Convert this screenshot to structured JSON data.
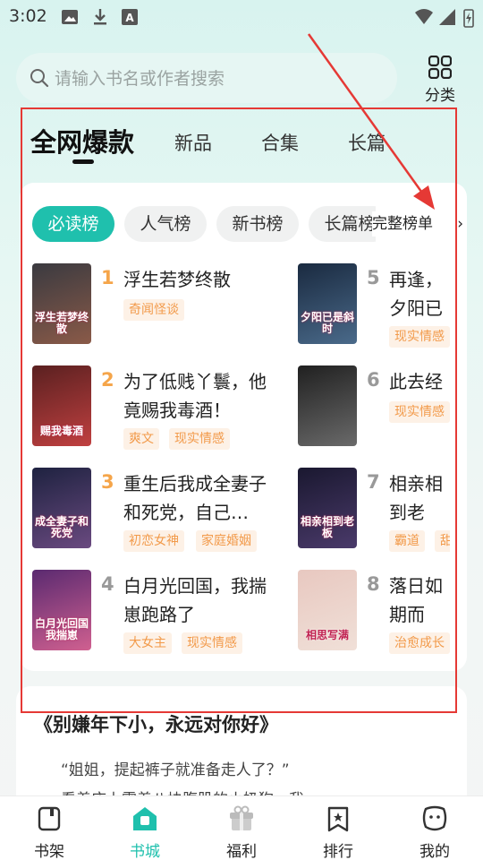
{
  "status": {
    "time": "3:02"
  },
  "search": {
    "placeholder": "请输入书名或作者搜索"
  },
  "category": {
    "label": "分类"
  },
  "main_tabs": [
    {
      "label": "全网爆款",
      "active": true
    },
    {
      "label": "新品"
    },
    {
      "label": "合集"
    },
    {
      "label": "长篇"
    }
  ],
  "chips": [
    {
      "label": "必读榜",
      "active": true
    },
    {
      "label": "人气榜"
    },
    {
      "label": "新书榜"
    },
    {
      "label": "长篇榜"
    }
  ],
  "full_list": {
    "label": "完整榜单"
  },
  "books": [
    {
      "rank": "1",
      "title": "浮生若梦终散",
      "tags": [
        "奇闻怪谈"
      ],
      "cover_text": "浮生若梦终散",
      "cover_colors": [
        "#3a3a40",
        "#8a5a48"
      ]
    },
    {
      "rank": "2",
      "title": "为了低贱丫鬟，他竟赐我毒酒！",
      "tags": [
        "爽文",
        "现实情感"
      ],
      "cover_text": "赐我毒酒",
      "cover_colors": [
        "#5a2020",
        "#c04040"
      ]
    },
    {
      "rank": "3",
      "title": "重生后我成全妻子和死党，自己…",
      "tags": [
        "初恋女神",
        "家庭婚姻"
      ],
      "cover_text": "成全妻子和死党",
      "cover_colors": [
        "#1e2240",
        "#6a4a80"
      ]
    },
    {
      "rank": "4",
      "title": "白月光回国，我揣崽跑路了",
      "tags": [
        "大女主",
        "现实情感"
      ],
      "cover_text": "白月光回国我揣崽",
      "cover_colors": [
        "#5a2a70",
        "#d06090"
      ]
    },
    {
      "rank": "5",
      "title": "再逢，夕阳已是斜时",
      "tags": [
        "现实情感"
      ],
      "cover_text": "夕阳已是斜时",
      "cover_colors": [
        "#1a2a40",
        "#4a6a8a"
      ]
    },
    {
      "rank": "6",
      "title": "此去经年",
      "tags": [
        "现实情感"
      ],
      "cover_text": "",
      "cover_colors": [
        "#202020",
        "#6a6a6a"
      ]
    },
    {
      "rank": "7",
      "title": "相亲相到老板，一尖种怎样的体验",
      "tags": [
        "霸道",
        "甜宠"
      ],
      "cover_text": "相亲相到老板",
      "cover_colors": [
        "#1a1830",
        "#4a3a6a"
      ]
    },
    {
      "rank": "8",
      "title": "落日如期而至，相思写满",
      "tags": [
        "治愈成长"
      ],
      "cover_text": "相思写满",
      "cover_colors": [
        "#e8c8c0",
        "#f0e0d8"
      ]
    }
  ],
  "recommendation": {
    "title": "《别嫌年下小，永远对你好》",
    "quote": "“姐姐，提起裤子就准备走人了？”",
    "line": "看着床上露着八块腹肌的小奶狗，我"
  },
  "bottom_nav": [
    {
      "label": "书架",
      "icon": "bookshelf-icon"
    },
    {
      "label": "书城",
      "icon": "bookstore-icon",
      "active": true
    },
    {
      "label": "福利",
      "icon": "gift-icon"
    },
    {
      "label": "排行",
      "icon": "ranking-icon"
    },
    {
      "label": "我的",
      "icon": "profile-icon"
    }
  ],
  "colors": {
    "accent": "#1fc0ad",
    "tag_text": "#f29a4a",
    "rank_orange": "#f5a54a",
    "rank_gray": "#999999",
    "annotation": "#e53935"
  }
}
